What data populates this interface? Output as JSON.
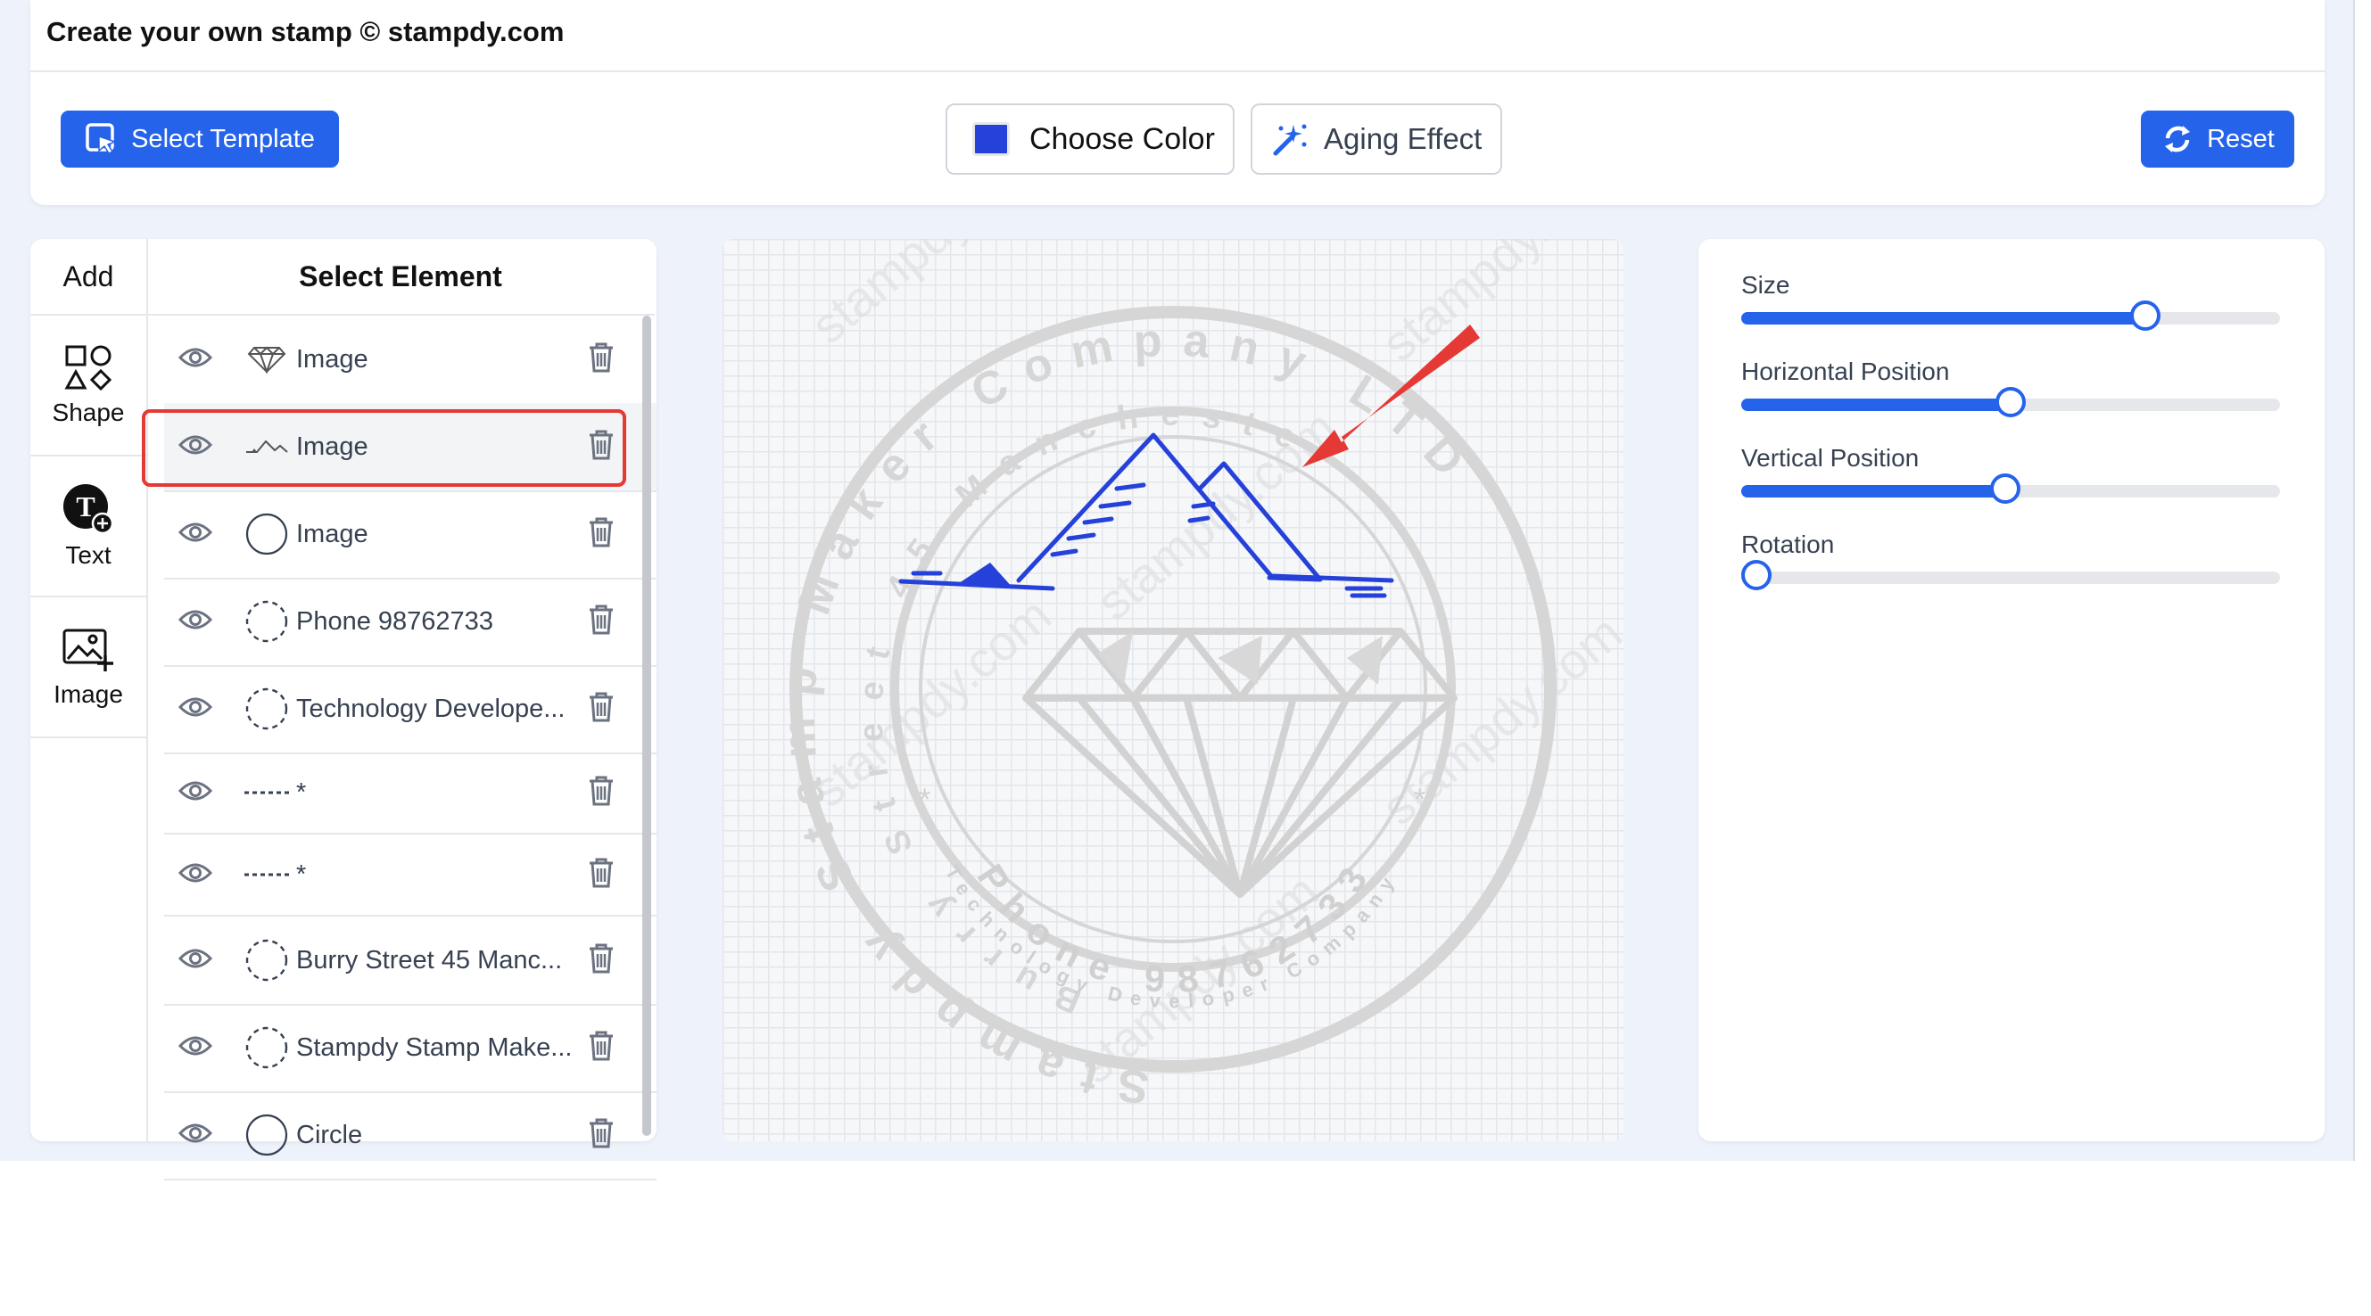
{
  "header": {
    "title": "Create your own stamp © stampdy.com",
    "select_template": "Select Template",
    "choose_color": "Choose Color",
    "aging_effect": "Aging Effect",
    "reset": "Reset",
    "swatch_color": "#2541d9"
  },
  "add_panel": {
    "title": "Add",
    "items": [
      {
        "label": "Shape",
        "icon": "shapes-icon"
      },
      {
        "label": "Text",
        "icon": "text-add-icon"
      },
      {
        "label": "Image",
        "icon": "image-add-icon"
      }
    ]
  },
  "elements": {
    "title": "Select Element",
    "selected_index": 1,
    "items": [
      {
        "label": "Image",
        "thumb": "diamond"
      },
      {
        "label": "Image",
        "thumb": "mountain"
      },
      {
        "label": "Image",
        "thumb": "circle-solid"
      },
      {
        "label": "Phone 98762733",
        "thumb": "circle-dashed"
      },
      {
        "label": "Technology Develope...",
        "thumb": "circle-dashed"
      },
      {
        "label": "*",
        "thumb": "dashes"
      },
      {
        "label": "*",
        "thumb": "dashes"
      },
      {
        "label": "Burry Street 45 Manc...",
        "thumb": "circle-dashed"
      },
      {
        "label": "Stampdy Stamp Make...",
        "thumb": "circle-dashed"
      },
      {
        "label": "Circle",
        "thumb": "circle-solid"
      }
    ]
  },
  "stamp": {
    "outer_text": "Stampdy Stamp Maker Company LTD",
    "inner_text": "Burry Street 45 Manchester",
    "small_text": "Technology Developer Company",
    "phone_text": "Phone 98762733",
    "star": "*",
    "watermark": "stampdy.com",
    "accent_color": "#2541d9",
    "ghost_color": "#d6d6d6"
  },
  "controls": {
    "size": {
      "label": "Size",
      "value": 0.75
    },
    "horizontal": {
      "label": "Horizontal Position",
      "value": 0.5
    },
    "vertical": {
      "label": "Vertical Position",
      "value": 0.49
    },
    "rotation": {
      "label": "Rotation",
      "value": 0.0
    }
  }
}
